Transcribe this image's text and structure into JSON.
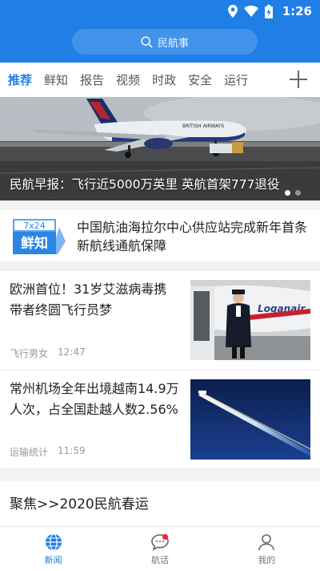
{
  "status_bar": {
    "time": "1:26",
    "icons": [
      "location-icon",
      "wifi-icon",
      "battery-icon"
    ]
  },
  "search": {
    "placeholder": "民航事",
    "icon": "search-icon"
  },
  "tabs": [
    {
      "label": "推荐",
      "active": true
    },
    {
      "label": "鲜知"
    },
    {
      "label": "报告"
    },
    {
      "label": "视频"
    },
    {
      "label": "时政"
    },
    {
      "label": "安全"
    },
    {
      "label": "运行"
    }
  ],
  "banner": {
    "caption": "民航早报：飞行近5000万英里 英航首架777退役",
    "aircraft_text": "BRITISH AIRWAYS",
    "dots_total": 2,
    "dot_active": 1
  },
  "flash": {
    "badge_top": "7x24",
    "badge_main": "鲜知",
    "text": "中国航油海拉尔中心供应站完成新年首条新航线通航保障"
  },
  "news": [
    {
      "title": "欧洲首位！31岁艾滋病毒携带者终圆飞行员梦",
      "source": "飞行男女",
      "time": "12:47",
      "image_text": "Loganair"
    },
    {
      "title": "常州机场全年出境越南14.9万人次，占全国赴越人数2.56%",
      "source": "运输统计",
      "time": "11:59"
    }
  ],
  "focus": {
    "title": "聚焦>>2020民航春运"
  },
  "bottom_nav": [
    {
      "label": "新闻",
      "icon": "globe-icon",
      "active": true
    },
    {
      "label": "航话",
      "icon": "chat-icon",
      "badge": true
    },
    {
      "label": "我的",
      "icon": "user-icon"
    }
  ],
  "colors": {
    "primary": "#1f7fe6",
    "badge_red": "#ee2233"
  }
}
